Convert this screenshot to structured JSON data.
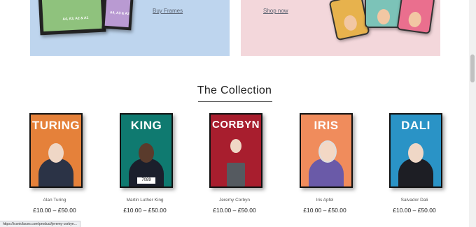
{
  "banners": {
    "frames": {
      "link": "Buy Frames",
      "art_text_1": "A4, A3, A2 & A1",
      "art_text_2": "A4, A3 & A2"
    },
    "cases": {
      "link": "Shop now"
    }
  },
  "section": {
    "title": "The Collection"
  },
  "products": [
    {
      "poster_word": "TURING",
      "bg": "#e5813a",
      "figure": "#2b3346",
      "name": "Alan Turing",
      "price": "£10.00 – £50.00"
    },
    {
      "poster_word": "KING",
      "bg": "#0f7a70",
      "figure": "#1b1f2c",
      "name": "Martin Luther King",
      "price": "£10.00 – £50.00",
      "tag": "7089"
    },
    {
      "poster_word": "CORBYN",
      "bg": "#a81e2e",
      "figure": "#555a60",
      "name": "Jeremy Corbyn",
      "price": "£10.00 – £50.00"
    },
    {
      "poster_word": "IRIS",
      "bg": "#f08c5c",
      "figure": "#6a5aa8",
      "name": "Iris Apfel",
      "price": "£10.00 – £50.00"
    },
    {
      "poster_word": "DALI",
      "bg": "#2a93c6",
      "figure": "#1d1e24",
      "name": "Salvador Dali",
      "price": "£10.00 – £50.00"
    }
  ],
  "status": {
    "url": "https://iconicfaces.com/product/jeremy-corbyn..."
  }
}
